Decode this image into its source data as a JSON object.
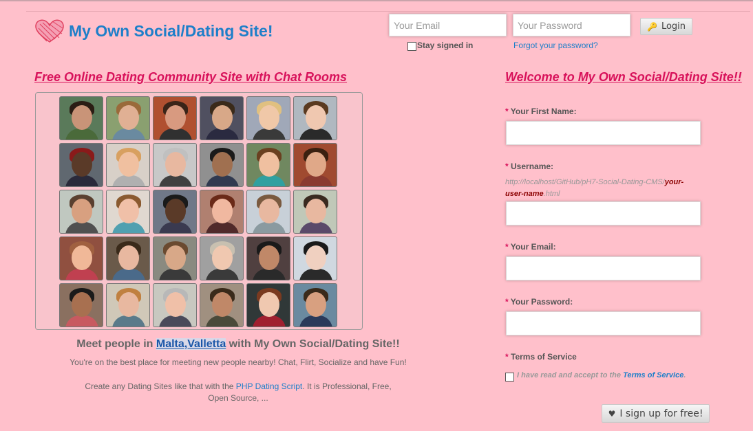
{
  "header": {
    "site_title": "My Own Social/Dating Site!",
    "email_placeholder": "Your Email",
    "password_placeholder": "Your Password",
    "login_label": "Login",
    "stay_signed_in": "Stay signed in",
    "forgot_password": "Forgot your password?"
  },
  "left": {
    "heading": "Free Online Dating Community Site with Chat Rooms",
    "meet_prefix": "Meet people in ",
    "meet_location": "Malta,Valletta",
    "meet_suffix": " with My Own Social/Dating Site!!",
    "desc_line1": "You're on the best place for meeting new people nearby! Chat, Flirt, Socialize and have Fun!",
    "desc_line2_prefix": "Create any Dating Sites like that with the ",
    "desc_link": "PHP Dating Script",
    "desc_line2_suffix": ". It is Professional, Free, Open Source, ...",
    "avatars": [
      {
        "skin": "#c99478",
        "hair": "#2b1d14",
        "shirt": "#4a6a3a",
        "bg": "#5a7a5a"
      },
      {
        "skin": "#e0b094",
        "hair": "#9a6a3a",
        "shirt": "#6a8aa0",
        "bg": "#8aa070"
      },
      {
        "skin": "#d89a80",
        "hair": "#3a2418",
        "shirt": "#303030",
        "bg": "#b05030"
      },
      {
        "skin": "#d8a888",
        "hair": "#3a2a1a",
        "shirt": "#2a2a40",
        "bg": "#505060"
      },
      {
        "skin": "#f0c8a8",
        "hair": "#e0c080",
        "shirt": "#3a3a3a",
        "bg": "#a0a8b8"
      },
      {
        "skin": "#f0c8b0",
        "hair": "#5a3a20",
        "shirt": "#2a2a2a",
        "bg": "#b0b8c0"
      },
      {
        "skin": "#5a3a28",
        "hair": "#8a1a1a",
        "shirt": "#2a2a3a",
        "bg": "#606870"
      },
      {
        "skin": "#f0c0a0",
        "hair": "#d8a060",
        "shirt": "#b0b0b0",
        "bg": "#d8d0c8"
      },
      {
        "skin": "#e8b8a0",
        "hair": "#c0c0c0",
        "shirt": "#404040",
        "bg": "#c8c8c8"
      },
      {
        "skin": "#a07050",
        "hair": "#1a1a1a",
        "shirt": "#303a50",
        "bg": "#909090"
      },
      {
        "skin": "#f0c0a0",
        "hair": "#6a4020",
        "shirt": "#30a0a0",
        "bg": "#708860"
      },
      {
        "skin": "#e0a888",
        "hair": "#3a2010",
        "shirt": "#8a3a30",
        "bg": "#a04a30"
      },
      {
        "skin": "#d8a080",
        "hair": "#5a4030",
        "shirt": "#505050",
        "bg": "#c0c8c0"
      },
      {
        "skin": "#f0c0a8",
        "hair": "#8a5a30",
        "shirt": "#50a0b0",
        "bg": "#e0d8d0"
      },
      {
        "skin": "#5a3a28",
        "hair": "#1a1a1a",
        "shirt": "#3a3a50",
        "bg": "#707888"
      },
      {
        "skin": "#f0b8a0",
        "hair": "#6a2a18",
        "shirt": "#502a2a",
        "bg": "#b08070"
      },
      {
        "skin": "#e8b8a0",
        "hair": "#7a5a40",
        "shirt": "#8a9aa0",
        "bg": "#c8d0d8"
      },
      {
        "skin": "#e8b8a0",
        "hair": "#3a2a20",
        "shirt": "#5a4a6a",
        "bg": "#c0c8b8"
      },
      {
        "skin": "#f0b898",
        "hair": "#a06040",
        "shirt": "#c04050",
        "bg": "#905040"
      },
      {
        "skin": "#e8b8a0",
        "hair": "#3a2a1a",
        "shirt": "#4a6a8a",
        "bg": "#6a5a4a"
      },
      {
        "skin": "#d8a888",
        "hair": "#6a4a30",
        "shirt": "#3a3a3a",
        "bg": "#8a8a80"
      },
      {
        "skin": "#f0c8b0",
        "hair": "#c8c0b0",
        "shirt": "#3a3a3a",
        "bg": "#a0a0a0"
      },
      {
        "skin": "#c08868",
        "hair": "#1a1a1a",
        "shirt": "#2a2a2a",
        "bg": "#504040"
      },
      {
        "skin": "#f0d0c0",
        "hair": "#1a1a1a",
        "shirt": "#2a2a2a",
        "bg": "#d0d8e0"
      },
      {
        "skin": "#a87050",
        "hair": "#1a1a1a",
        "shirt": "#c85a60",
        "bg": "#8a7060"
      },
      {
        "skin": "#e8b8a0",
        "hair": "#c08040",
        "shirt": "#5a7a8a",
        "bg": "#d0c8b8"
      },
      {
        "skin": "#f0c0a8",
        "hair": "#b8b8b8",
        "shirt": "#4a4a5a",
        "bg": "#c8c8c0"
      },
      {
        "skin": "#c08868",
        "hair": "#3a2a1a",
        "shirt": "#4a4a3a",
        "bg": "#a09080"
      },
      {
        "skin": "#f0c8b0",
        "hair": "#7a3a20",
        "shirt": "#a02030",
        "bg": "#303838"
      },
      {
        "skin": "#d8a080",
        "hair": "#3a2a1a",
        "shirt": "#2a3a5a",
        "bg": "#6a8aa0"
      }
    ]
  },
  "right": {
    "heading": "Welcome to My Own Social/Dating Site!!",
    "first_name_label": "Your First Name:",
    "username_label": "Username:",
    "username_url_prefix": "http://localhost/GitHub/pH7-Social-Dating-CMS/",
    "username_url_name": "your-user-name",
    "username_url_suffix": ".html",
    "email_label": "Your Email:",
    "password_label": "Your Password:",
    "terms_label": "Terms of Service",
    "terms_text_prefix": "I have read and accept to the ",
    "terms_link": "Terms of Service",
    "terms_text_suffix": ".",
    "signup_label": "I sign up for free!",
    "required_mark": "*"
  },
  "colors": {
    "background": "#ffc0cb",
    "accent_pink": "#d8125b",
    "link_blue": "#1e7fc9"
  }
}
